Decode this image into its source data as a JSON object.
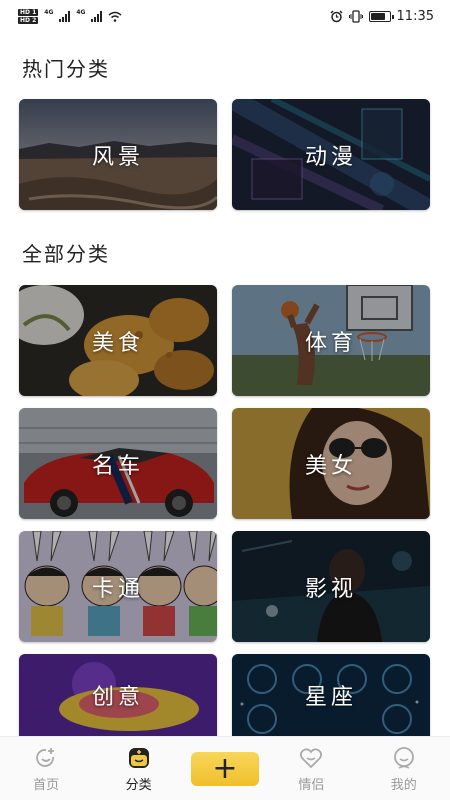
{
  "status_bar": {
    "hd1": "HD 1",
    "hd2": "HD 2",
    "net1": "4G",
    "net2": "4G",
    "time": "11:35",
    "battery_level": 0.8
  },
  "sections": {
    "hot": "热门分类",
    "all": "全部分类"
  },
  "hot_categories": [
    {
      "label": "风景",
      "icon": "landscape-image"
    },
    {
      "label": "动漫",
      "icon": "anime-image"
    }
  ],
  "all_categories": [
    {
      "label": "美食",
      "icon": "food-image"
    },
    {
      "label": "体育",
      "icon": "sports-image"
    },
    {
      "label": "名车",
      "icon": "car-image"
    },
    {
      "label": "美女",
      "icon": "beauty-image"
    },
    {
      "label": "卡通",
      "icon": "cartoon-image"
    },
    {
      "label": "影视",
      "icon": "film-image"
    },
    {
      "label": "创意",
      "icon": "creative-image"
    },
    {
      "label": "星座",
      "icon": "zodiac-image"
    }
  ],
  "bottom_nav": {
    "home": "首页",
    "category": "分类",
    "add": "+",
    "couple": "情侣",
    "mine": "我的"
  },
  "colors": {
    "accent": "#f0bf2c",
    "inactive": "#999999"
  }
}
